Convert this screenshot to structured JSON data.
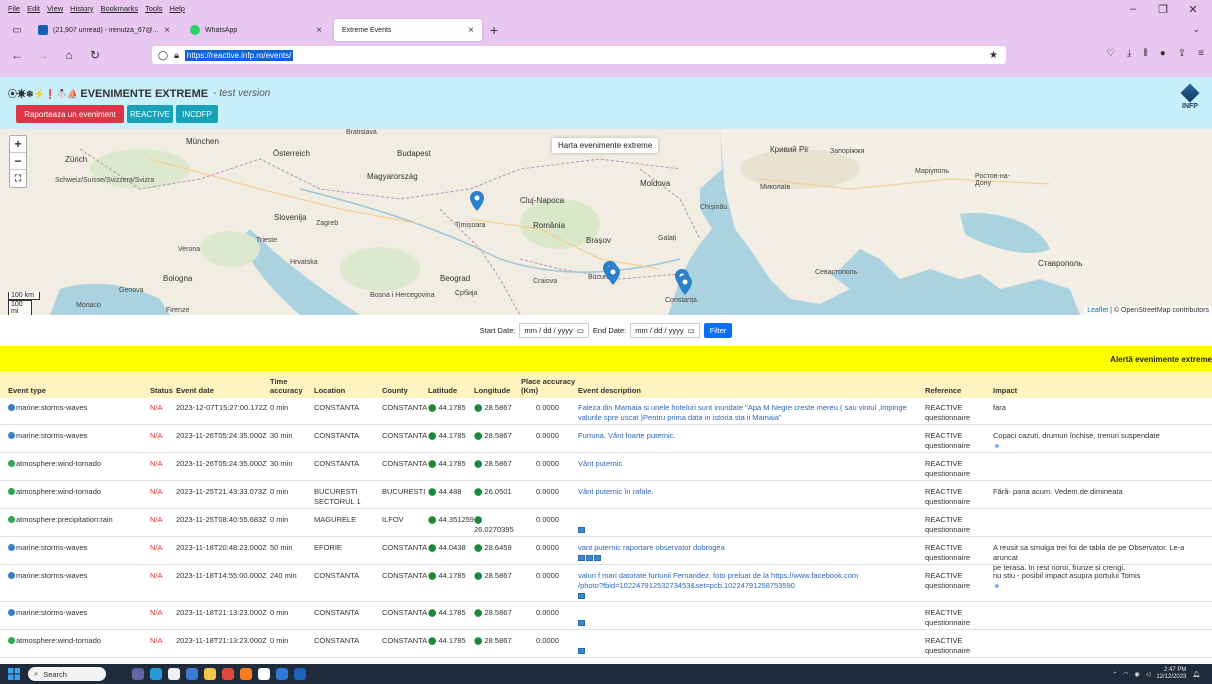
{
  "browser": {
    "menu": [
      "File",
      "Edit",
      "View",
      "History",
      "Bookmarks",
      "Tools",
      "Help"
    ],
    "tabs": [
      {
        "label": "(21,907 unread) - irenutza_67@...",
        "color": "#1a5fb4"
      },
      {
        "label": "WhatsApp",
        "color": "#25d366"
      },
      {
        "label": "Extreme Events",
        "color": "#888888"
      }
    ],
    "url": "https://reactive.infp.ro/events/"
  },
  "header": {
    "title": "EVENIMENTE EXTREME",
    "subtitle": "- test version",
    "buttons": {
      "report": "Raporteaza un eveniment",
      "reactive": "REACTIVE",
      "incdfp": "INCDFP"
    },
    "logo_text": "INFP"
  },
  "map": {
    "title": "Harta evenimente extreme",
    "scale_km": "100 km",
    "scale_mi": "100 mi",
    "attribution_leaflet": "Leaflet",
    "attribution_osm": "© OpenStreetMap contributors",
    "labels": [
      {
        "text": "München"
      },
      {
        "text": "Zürich"
      },
      {
        "text": "Schweiz/Suisse/Svizzera/Svizra"
      },
      {
        "text": "Österreich"
      },
      {
        "text": "Bratislava"
      },
      {
        "text": "Budapest"
      },
      {
        "text": "Magyarország"
      },
      {
        "text": "Slovenija"
      },
      {
        "text": "Zagreb"
      },
      {
        "text": "Hrvatska"
      },
      {
        "text": "Bosna i Hercegovina"
      },
      {
        "text": "Beograd"
      },
      {
        "text": "Србија"
      },
      {
        "text": "Cluj-Napoca"
      },
      {
        "text": "România"
      },
      {
        "text": "Timișoara"
      },
      {
        "text": "Brașov"
      },
      {
        "text": "Craiova"
      },
      {
        "text": "București"
      },
      {
        "text": "Constanța"
      },
      {
        "text": "Moldova"
      },
      {
        "text": "Galați"
      },
      {
        "text": "Кривий Ріг"
      },
      {
        "text": "Запоріжжя"
      },
      {
        "text": "Маріуполь"
      },
      {
        "text": "Ростов-на-Дону"
      },
      {
        "text": "Миколаїв"
      },
      {
        "text": "Севастополь"
      },
      {
        "text": "Ставрополь"
      },
      {
        "text": "Genova"
      },
      {
        "text": "Bologna"
      },
      {
        "text": "Firenze"
      },
      {
        "text": "Monaco"
      },
      {
        "text": "Verona"
      },
      {
        "text": "Trieste"
      },
      {
        "text": "Chișinău"
      }
    ]
  },
  "filter": {
    "start_label": "Start Date:",
    "end_label": "End Date:",
    "date_placeholder": "mm / dd / yyyy",
    "button": "Filter"
  },
  "alert_text": "Alertă evenimente extreme",
  "table": {
    "headers": {
      "event_type": "Event type",
      "status": "Status",
      "event_date": "Event date",
      "time_accuracy_1": "Time",
      "time_accuracy_2": "accuracy",
      "location": "Location",
      "county": "County",
      "latitude": "Latitude",
      "longitude": "Longitude",
      "place_accuracy_1": "Place accuracy",
      "place_accuracy_2": "(Km)",
      "description": "Event description",
      "reference": "Reference",
      "impact": "Impact"
    },
    "rows": [
      {
        "type": "marine:storms-waves",
        "dot": "#3b7bd4",
        "status": "N/A",
        "date": "2023-12-07T15:27:00.172Z",
        "acc": "0 min",
        "loc": "CONSTANTA",
        "loc2": "",
        "county": "CONSTANTA",
        "lat": "44.1785",
        "lon": "28.5867",
        "lon2": "",
        "pacc": "0.0000",
        "desc": "Faleza din Mamaia si unele hoteluri sunt inundate \"Apa M Negre creste mereu ( sau vintul ,impinge",
        "desc2": "valurile spre uscat )Pentru prima data in istoria sta ii Mamaia\"",
        "imgs": 0,
        "ref1": "REACTIVE",
        "ref2": "questionnaire",
        "impact": "fara",
        "impact2": "",
        "impact_link": false
      },
      {
        "type": "marine:storms-waves",
        "dot": "#3b7bd4",
        "status": "N/A",
        "date": "2023-11-26T05:24:35.000Z",
        "acc": "30 min",
        "loc": "CONSTANTA",
        "loc2": "",
        "county": "CONSTANTA",
        "lat": "44.1785",
        "lon": "28.5867",
        "lon2": "",
        "pacc": "0.0000",
        "desc": "Furtuna. Vânt foarte puternic.",
        "desc2": "",
        "imgs": 0,
        "ref1": "REACTIVE",
        "ref2": "questionnaire",
        "impact": "Copaci cazuti, drumuri închise, trenuri suspendate",
        "impact2": "",
        "impact_link": true
      },
      {
        "type": "atmosphere:wind-tornado",
        "dot": "#2fa84f",
        "status": "N/A",
        "date": "2023-11-26T05:24:35.000Z",
        "acc": "30 min",
        "loc": "CONSTANTA",
        "loc2": "",
        "county": "CONSTANTA",
        "lat": "44.1785",
        "lon": "28.5867",
        "lon2": "",
        "pacc": "0.0000",
        "desc": "Vânt puternic",
        "desc2": "",
        "imgs": 0,
        "ref1": "REACTIVE",
        "ref2": "questionnaire",
        "impact": "",
        "impact2": "",
        "impact_link": false
      },
      {
        "type": "atmosphere:wind-tornado",
        "dot": "#2fa84f",
        "status": "N/A",
        "date": "2023-11-25T21:43:33.073Z",
        "acc": "0 min",
        "loc": "BUCURESTI",
        "loc2": "SECTORUL 1",
        "county": "BUCURESTI",
        "lat": "44.488",
        "lon": "26.0501",
        "lon2": "",
        "pacc": "0.0000",
        "desc": "Vânt puternic în rafale.",
        "desc2": "",
        "imgs": 0,
        "ref1": "REACTIVE",
        "ref2": "questionnaire",
        "impact": "Fără- pana acum. Vedem.de.dimineata",
        "impact2": "",
        "impact_link": false
      },
      {
        "type": "atmosphere:precipitation:rain",
        "dot": "#2fa84f",
        "status": "N/A",
        "date": "2023-11-25T08:40:55.683Z",
        "acc": "0 min",
        "loc": "MAGURELE",
        "loc2": "",
        "county": "ILFOV",
        "lat": "44.351259",
        "lon": "",
        "lon2": "26.0270395",
        "pacc": "0.0000",
        "desc": "",
        "desc2": "",
        "imgs": 1,
        "ref1": "REACTIVE",
        "ref2": "questionnaire",
        "impact": "",
        "impact2": "",
        "impact_link": false
      },
      {
        "type": "marine:storms-waves",
        "dot": "#3b7bd4",
        "status": "N/A",
        "date": "2023-11-18T20:48:23.000Z",
        "acc": "50 min",
        "loc": "EFORIE",
        "loc2": "",
        "county": "CONSTANTA",
        "lat": "44.0438",
        "lon": "28.6459",
        "lon2": "",
        "pacc": "0.0000",
        "desc": "vant puternic raportare observator dobrogea",
        "desc2": "",
        "imgs": 3,
        "ref1": "REACTIVE",
        "ref2": "questionnaire",
        "impact": "A reusit sa smulga trei foi de tabla de pe Observator. Le-a aruncat",
        "impact2": "pe terasa. In rest noroi, frunze și crengi.",
        "impact_link": false
      },
      {
        "type": "marine:storms-waves",
        "dot": "#3b7bd4",
        "status": "N/A",
        "date": "2023-11-18T14:55:00.000Z",
        "acc": "240 min",
        "loc": "CONSTANTA",
        "loc2": "",
        "county": "CONSTANTA",
        "lat": "44.1785",
        "lon": "28.5867",
        "lon2": "",
        "pacc": "0.0000",
        "desc": "valuri f mari datorate furtunii Fernandez. foto preluat de la https://www.facebook.com",
        "desc2": "/photo?fbid=10224791253273453&set=pcb.10224791258753590",
        "imgs": 1,
        "ref1": "REACTIVE",
        "ref2": "questionnaire",
        "impact": "nu stiu - posibil impact asupra portului Tomis",
        "impact2": "",
        "impact_link": true
      },
      {
        "type": "marine:storms-waves",
        "dot": "#3b7bd4",
        "status": "N/A",
        "date": "2023-11-18T21:13:23.000Z",
        "acc": "0 min",
        "loc": "CONSTANTA",
        "loc2": "",
        "county": "CONSTANTA",
        "lat": "44.1785",
        "lon": "28.5867",
        "lon2": "",
        "pacc": "0.0000",
        "desc": "",
        "desc2": "",
        "imgs": 1,
        "ref1": "REACTIVE",
        "ref2": "questionnaire",
        "impact": "",
        "impact2": "",
        "impact_link": false
      },
      {
        "type": "atmosphere:wind-tornado",
        "dot": "#2fa84f",
        "status": "N/A",
        "date": "2023-11-18T21:13:23.000Z",
        "acc": "0 min",
        "loc": "CONSTANTA",
        "loc2": "",
        "county": "CONSTANTA",
        "lat": "44.1785",
        "lon": "28.5867",
        "lon2": "",
        "pacc": "0.0000",
        "desc": "",
        "desc2": "",
        "imgs": 1,
        "ref1": "REACTIVE",
        "ref2": "questionnaire",
        "impact": "",
        "impact2": "",
        "impact_link": false
      }
    ]
  },
  "taskbar": {
    "search": "Search",
    "time": "2:47 PM",
    "date": "12/12/2023"
  }
}
